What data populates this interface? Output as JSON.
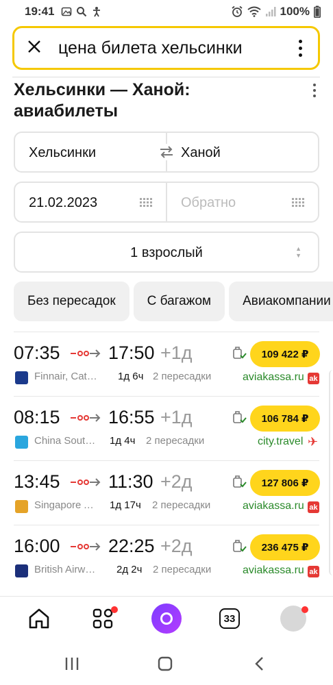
{
  "status_bar": {
    "time": "19:41",
    "battery": "100%",
    "icons": [
      "photo-icon",
      "search-icon",
      "accessibility-icon",
      "alarm-icon",
      "wifi-icon",
      "signal-icon",
      "battery-icon"
    ]
  },
  "search": {
    "query": "цена билета хельсинки",
    "close_icon": "close-icon",
    "menu_icon": "more-vertical-icon"
  },
  "page": {
    "title_line1": "Хельсинки — Ханой:",
    "title_line2": "авиабилеты"
  },
  "form": {
    "from": "Хельсинки",
    "to": "Ханой",
    "date_there": "21.02.2023",
    "date_back_placeholder": "Обратно",
    "passengers": "1 взрослый"
  },
  "filters": [
    "Без пересадок",
    "С багажом",
    "Авиакомпании"
  ],
  "flights": [
    {
      "dep": "07:35",
      "arr": "17:50",
      "plus": "+1д",
      "airline": "Finnair, Cathay Pacific",
      "duration": "1д 6ч",
      "stops": "2 пересадки",
      "price": "109 422 ₽",
      "agency": "aviakassa.ru",
      "airline_color": "#1b3a8c"
    },
    {
      "dep": "08:15",
      "arr": "16:55",
      "plus": "+1д",
      "airline": "China Southern",
      "duration": "1д 4ч",
      "stops": "2 пересадки",
      "price": "106 784 ₽",
      "agency": "city.travel",
      "airline_color": "#2aa6de"
    },
    {
      "dep": "13:45",
      "arr": "11:30",
      "plus": "+2д",
      "airline": "Singapore Airlines",
      "duration": "1д 17ч",
      "stops": "2 пересадки",
      "price": "127 806 ₽",
      "agency": "aviakassa.ru",
      "airline_color": "#e5a328"
    },
    {
      "dep": "16:00",
      "arr": "22:25",
      "plus": "+2д",
      "airline": "British Airways",
      "duration": "2д 2ч",
      "stops": "2 пересадки",
      "price": "236 475 ₽",
      "agency": "aviakassa.ru",
      "airline_color": "#1b2f7a"
    }
  ],
  "bottom_nav": {
    "tabs_count": "33",
    "items": [
      "home-icon",
      "services-icon",
      "alice-icon",
      "tabs-icon",
      "profile-icon"
    ]
  },
  "colors": {
    "accent": "#ffd51c",
    "search_border": "#f5c800",
    "agency_green": "#2a8a2a",
    "badge_red": "#e53935"
  }
}
